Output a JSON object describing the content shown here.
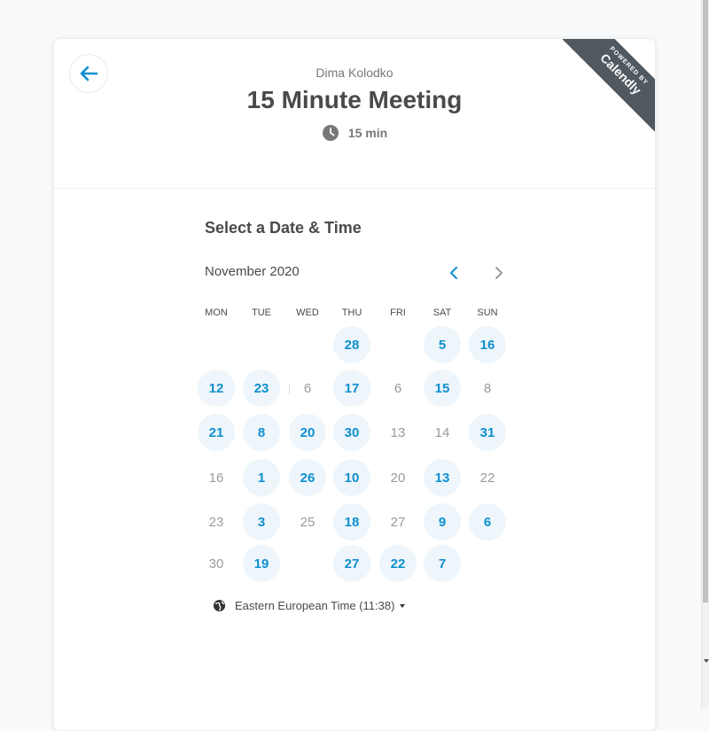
{
  "host": "Dima Kolodko",
  "event": {
    "title": "15 Minute Meeting",
    "duration": "15 min"
  },
  "badge": {
    "line1": "POWERED BY",
    "line2": "Calendly"
  },
  "section_title": "Select a Date & Time",
  "calendar": {
    "month": "November 2020",
    "weekdays": [
      "MON",
      "TUE",
      "WED",
      "THU",
      "FRI",
      "SAT",
      "SUN"
    ],
    "rows": [
      [
        null,
        null,
        null,
        {
          "d": "28",
          "a": true
        },
        null,
        {
          "d": "5",
          "a": true
        },
        {
          "d": "16",
          "a": true
        }
      ],
      [
        {
          "d": "12",
          "a": true
        },
        {
          "d": "23",
          "a": true
        },
        {
          "d": "6",
          "a": false
        },
        {
          "d": "17",
          "a": true
        },
        {
          "d": "6",
          "a": false
        },
        {
          "d": "15",
          "a": true
        },
        {
          "d": "8",
          "a": false
        }
      ],
      [
        {
          "d": "21",
          "a": true
        },
        {
          "d": "8",
          "a": true
        },
        {
          "d": "20",
          "a": true
        },
        {
          "d": "30",
          "a": true
        },
        {
          "d": "13",
          "a": false
        },
        {
          "d": "14",
          "a": false
        },
        {
          "d": "31",
          "a": true
        }
      ],
      [
        {
          "d": "16",
          "a": false
        },
        {
          "d": "1",
          "a": true
        },
        {
          "d": "26",
          "a": true
        },
        {
          "d": "10",
          "a": true
        },
        {
          "d": "20",
          "a": false
        },
        {
          "d": "13",
          "a": true
        },
        {
          "d": "22",
          "a": false
        }
      ],
      [
        {
          "d": "23",
          "a": false
        },
        {
          "d": "3",
          "a": true
        },
        {
          "d": "25",
          "a": false
        },
        {
          "d": "18",
          "a": true
        },
        {
          "d": "27",
          "a": false
        },
        {
          "d": "9",
          "a": true
        },
        {
          "d": "6",
          "a": true
        }
      ],
      [
        {
          "d": "30",
          "a": false
        },
        {
          "d": "19",
          "a": true
        },
        null,
        {
          "d": "27",
          "a": true
        },
        {
          "d": "22",
          "a": true
        },
        {
          "d": "7",
          "a": true
        },
        null
      ]
    ]
  },
  "timezone": "Eastern European Time (11:38)",
  "colors": {
    "accent": "#0e8fd0",
    "available_bg": "#eef6fb",
    "ribbon": "#505960"
  }
}
